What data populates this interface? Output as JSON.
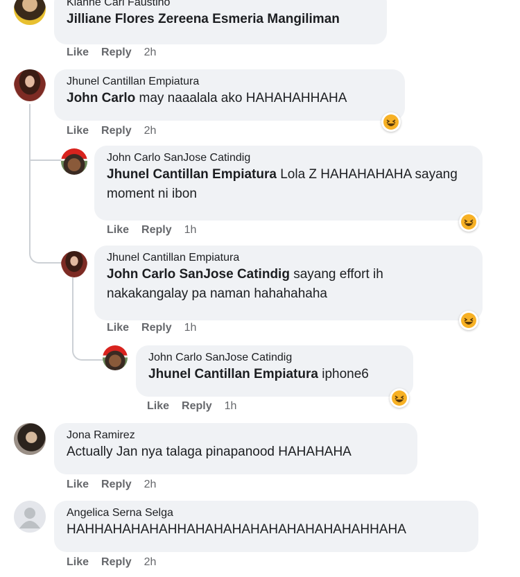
{
  "actions": {
    "like": "Like",
    "reply": "Reply"
  },
  "comments": [
    {
      "author": "Kianne Carl Faustino",
      "mention": "Jilliane Flores Zereena Esmeria Mangiliman",
      "text": "",
      "time": "2h"
    },
    {
      "author": "Jhunel Cantillan Empiatura",
      "mention": "John Carlo",
      "text": " may naaalala ako HAHAHAHHAHA",
      "time": "2h",
      "reaction": "haha"
    },
    {
      "author": "John Carlo SanJose Catindig",
      "mention": "Jhunel Cantillan Empiatura",
      "text": " Lola Z HAHAHAHAHA sayang moment ni ibon",
      "time": "1h",
      "reaction": "haha"
    },
    {
      "author": "Jhunel Cantillan Empiatura",
      "mention": "John Carlo SanJose Catindig",
      "text": " sayang effort ih nakakangalay pa naman hahahahaha",
      "time": "1h",
      "reaction": "haha"
    },
    {
      "author": "John Carlo SanJose Catindig",
      "mention": "Jhunel Cantillan Empiatura",
      "text": " iphone6",
      "time": "1h",
      "reaction": "haha"
    },
    {
      "author": "Jona Ramirez",
      "mention": "",
      "text": "Actually Jan nya talaga pinapanood HAHAHAHA",
      "time": "2h"
    },
    {
      "author": "Angelica Serna Selga",
      "mention": "",
      "text": "HAHHAHAHAHAHHAHAHAHAHAHAHAHAHAHAHHAHA",
      "time": "2h"
    }
  ],
  "colors": {
    "bubble": "#f0f2f5",
    "meta": "#65676b",
    "text": "#1c1e21",
    "reaction": "#f7b125"
  },
  "icons": [
    "avatar-photo",
    "santa-hat-avatar",
    "default-avatar-icon",
    "haha-reaction-icon"
  ]
}
